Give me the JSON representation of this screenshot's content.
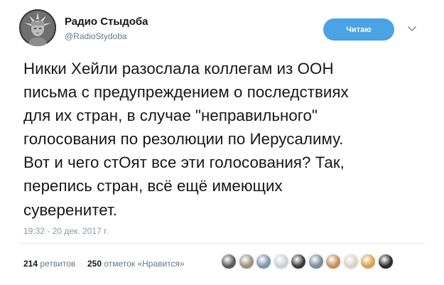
{
  "author": {
    "display_name": "Радио Стыдоба",
    "handle": "@RadioStydoba",
    "avatar_icon": "liberty-statue-avatar"
  },
  "follow_button": {
    "label": "Читаю"
  },
  "menu_icon": "chevron-down-icon",
  "tweet": {
    "lines": [
      "Никки Хейли разослала коллегам из ООН",
      "письма с предупреждением о последствиях",
      "для их стран, в случае \"неправильного\"",
      "голосования по резолюции по Иерусалиму.",
      "Вот и чего стОят все эти голосования? Так,",
      "перепись стран, всё ещё имеющих",
      "суверенитет."
    ],
    "timestamp": "19:32 - 20 дек. 2017 г."
  },
  "stats": {
    "retweets_count": "214",
    "retweets_label": "ретвитов",
    "likes_count": "250",
    "likes_label": "отметок «Нравится»"
  },
  "likers": {
    "colors": [
      "#5a5a5a",
      "#9c8f7a",
      "#7d95a8",
      "#c9d0d6",
      "#3b3b3b",
      "#7a8a96",
      "#c98b5a",
      "#d9d2c6",
      "#d6a34a",
      "#2b2b2b"
    ]
  },
  "colors": {
    "follow_button": "#4aa3e5",
    "text": "#14171a",
    "secondary_text": "#657786"
  }
}
